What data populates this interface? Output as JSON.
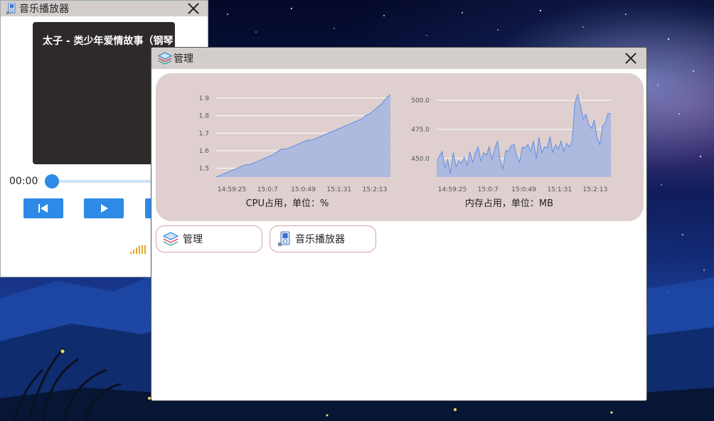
{
  "music_window": {
    "title": "音乐播放器",
    "song_title": "太子 - 类少年爱情故事（钢琴",
    "current_time": "00:00",
    "progress": 0,
    "buttons": [
      "previous",
      "play",
      "next"
    ]
  },
  "manager_window": {
    "title": "管理",
    "cpu_caption": "CPU占用，单位：%",
    "mem_caption": "内存占用，单位：MB",
    "tasks": [
      {
        "label": "管理",
        "icon": "layers-icon"
      },
      {
        "label": "音乐播放器",
        "icon": "music-player-icon"
      }
    ]
  },
  "chart_data": [
    {
      "type": "area",
      "title": "",
      "xlabel": "CPU占用，单位：%",
      "x_ticks": [
        "14:59:25",
        "15:0:7",
        "15:0:49",
        "15:1:31",
        "15:2:13"
      ],
      "y_ticks": [
        "1.5",
        "1.6",
        "1.7",
        "1.8",
        "1.9"
      ],
      "ylim": [
        1.45,
        1.92
      ],
      "values": [
        1.45,
        1.46,
        1.47,
        1.48,
        1.49,
        1.5,
        1.51,
        1.52,
        1.52,
        1.53,
        1.54,
        1.55,
        1.56,
        1.57,
        1.58,
        1.6,
        1.61,
        1.61,
        1.62,
        1.63,
        1.64,
        1.65,
        1.66,
        1.66,
        1.67,
        1.68,
        1.69,
        1.7,
        1.71,
        1.72,
        1.73,
        1.74,
        1.75,
        1.76,
        1.77,
        1.78,
        1.8,
        1.81,
        1.83,
        1.85,
        1.87,
        1.9,
        1.92
      ],
      "color": "#a9b6e0"
    },
    {
      "type": "area",
      "title": "",
      "xlabel": "内存占用，单位：MB",
      "x_ticks": [
        "14:59:25",
        "15:0:7",
        "15:0:49",
        "15:1:31",
        "15:2:13"
      ],
      "y_ticks": [
        "450.0",
        "475.0",
        "500.0"
      ],
      "ylim": [
        434,
        505
      ],
      "values": [
        448,
        452,
        456,
        442,
        449,
        437,
        455,
        443,
        448,
        446,
        451,
        444,
        456,
        447,
        455,
        460,
        448,
        455,
        453,
        460,
        449,
        458,
        465,
        448,
        441,
        457,
        456,
        461,
        462,
        452,
        447,
        460,
        459,
        462,
        456,
        465,
        450,
        468,
        455,
        460,
        459,
        469,
        455,
        462,
        458,
        465,
        456,
        463,
        460,
        465,
        498,
        505,
        495,
        484,
        488,
        479,
        476,
        483,
        468,
        462,
        478,
        481,
        489,
        488
      ],
      "color": "#a9b6e0"
    }
  ]
}
